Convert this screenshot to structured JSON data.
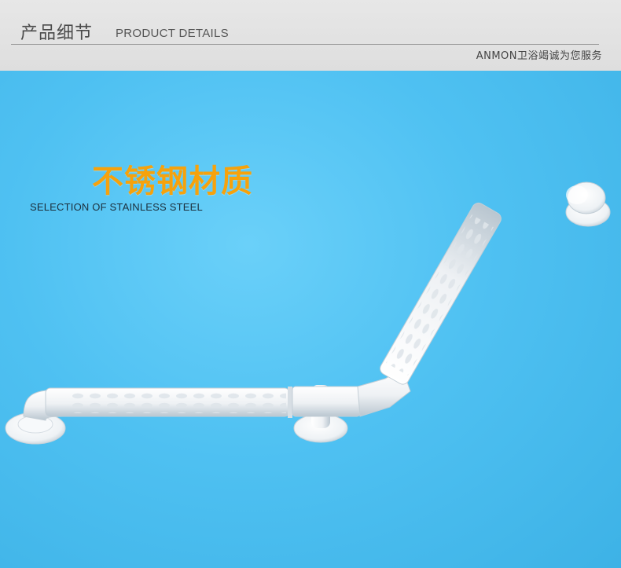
{
  "header": {
    "title_cn": "产品细节",
    "title_en": "PRODUCT DETAILS",
    "tagline": "ANMON卫浴竭诚为您服务"
  },
  "hero": {
    "headline": "不锈钢材质",
    "subline": "SELECTION OF STAINLESS STEEL"
  },
  "colors": {
    "header_bg": "#e2e2e2",
    "photo_bg": "#4fc1f2",
    "headline": "#f6a20c",
    "product": "#f5f6f8"
  },
  "image": {
    "subject": "grab-bar-icon"
  }
}
